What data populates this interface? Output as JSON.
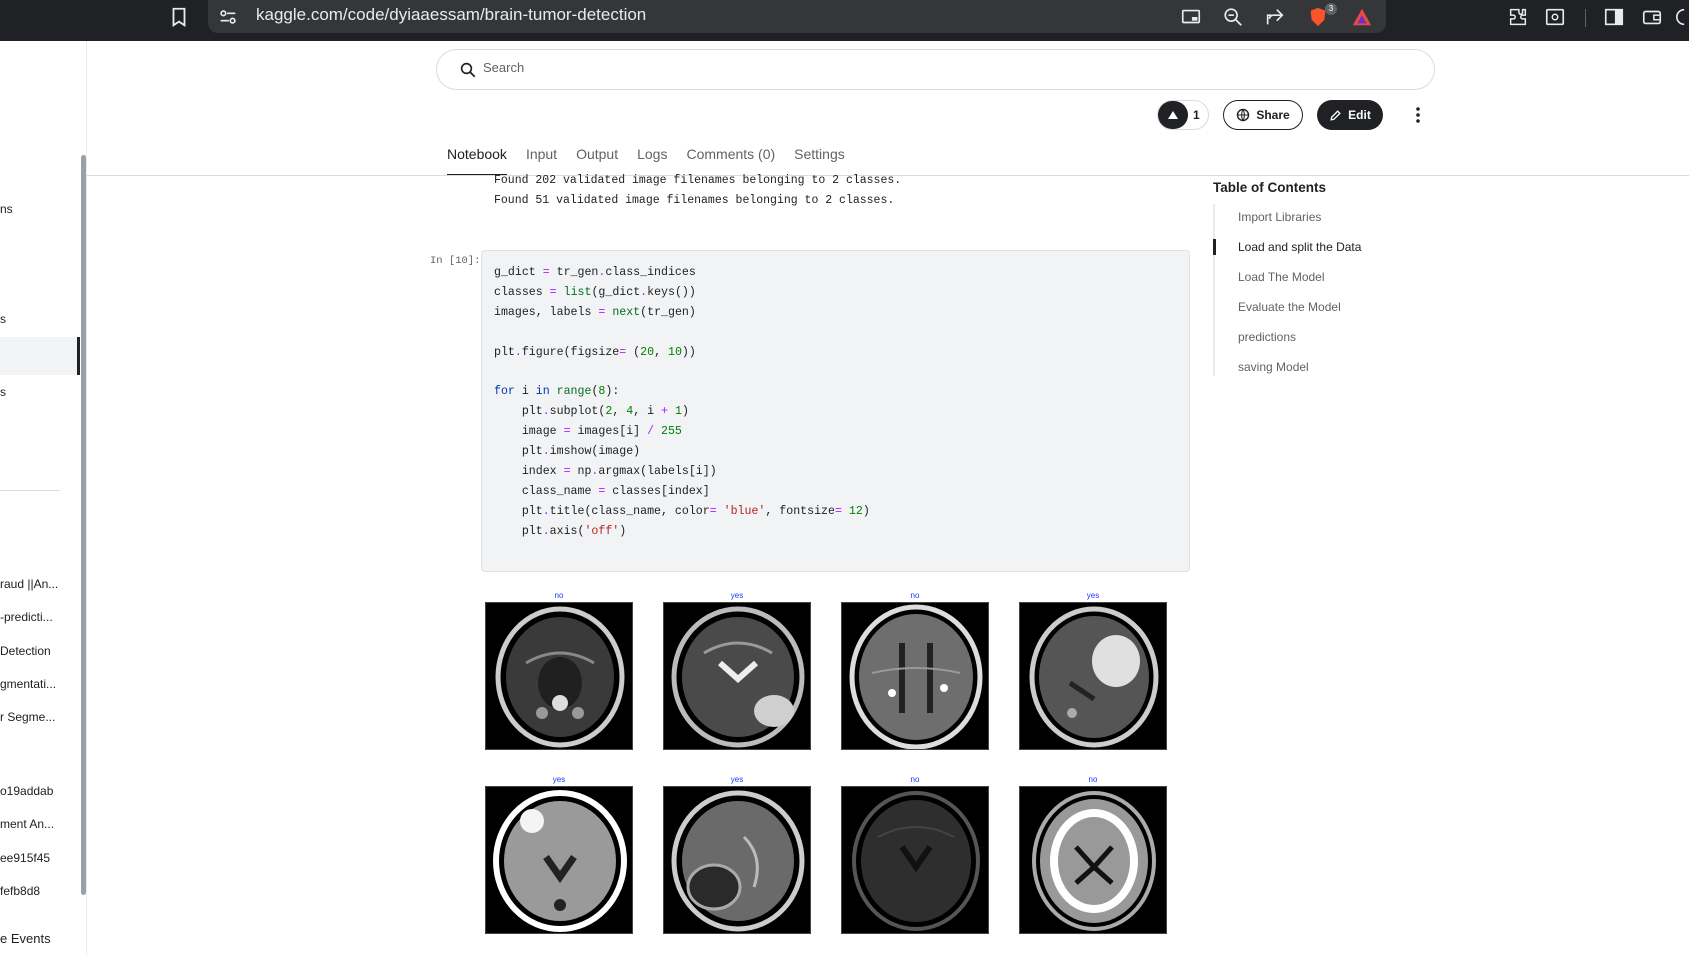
{
  "browser": {
    "url": "kaggle.com/code/dyiaaessam/brain-tumor-detection",
    "extension_badge": "3"
  },
  "left_sidebar": {
    "partial_items": [
      "ns",
      "s",
      "s"
    ],
    "recent_items": [
      "raud ||An...",
      "-predicti...",
      "Detection",
      "gmentati...",
      "r Segme...",
      "o19addab",
      "ment An...",
      "ee915f45",
      "fefb8d8",
      "e Events"
    ]
  },
  "search": {
    "placeholder": "Search"
  },
  "actions": {
    "upvote_count": "1",
    "share_label": "Share",
    "edit_label": "Edit"
  },
  "tabs": [
    {
      "label": "Notebook",
      "active": true
    },
    {
      "label": "Input",
      "active": false
    },
    {
      "label": "Output",
      "active": false
    },
    {
      "label": "Logs",
      "active": false
    },
    {
      "label": "Comments (0)",
      "active": false
    },
    {
      "label": "Settings",
      "active": false
    }
  ],
  "output_lines": [
    "Found 202 validated image filenames belonging to 2 classes.",
    "Found 51 validated image filenames belonging to 2 classes."
  ],
  "cell": {
    "prompt": "In [10]:",
    "code_lines": [
      "g_dict = tr_gen.class_indices",
      "classes = list(g_dict.keys())",
      "images, labels = next(tr_gen)",
      "",
      "plt.figure(figsize= (20, 10))",
      "",
      "for i in range(8):",
      "    plt.subplot(2, 4, i + 1)",
      "    image = images[i] / 255",
      "    plt.imshow(image)",
      "    index = np.argmax(labels[i])",
      "    class_name = classes[index]",
      "    plt.title(class_name, color= 'blue', fontsize= 12)",
      "    plt.axis('off')"
    ]
  },
  "toc": {
    "title": "Table of Contents",
    "items": [
      {
        "label": "Import Libraries",
        "active": false
      },
      {
        "label": "Load and split the Data",
        "active": true
      },
      {
        "label": "Load The Model",
        "active": false
      },
      {
        "label": "Evaluate the Model",
        "active": false
      },
      {
        "label": "predictions",
        "active": false
      },
      {
        "label": "saving Model",
        "active": false
      }
    ]
  },
  "images": [
    {
      "title": "no"
    },
    {
      "title": "yes"
    },
    {
      "title": "no"
    },
    {
      "title": "yes"
    },
    {
      "title": "yes"
    },
    {
      "title": "yes"
    },
    {
      "title": "no"
    },
    {
      "title": "no"
    }
  ],
  "colors": {
    "title_blue": "#1a36ff",
    "dark": "#202124"
  }
}
